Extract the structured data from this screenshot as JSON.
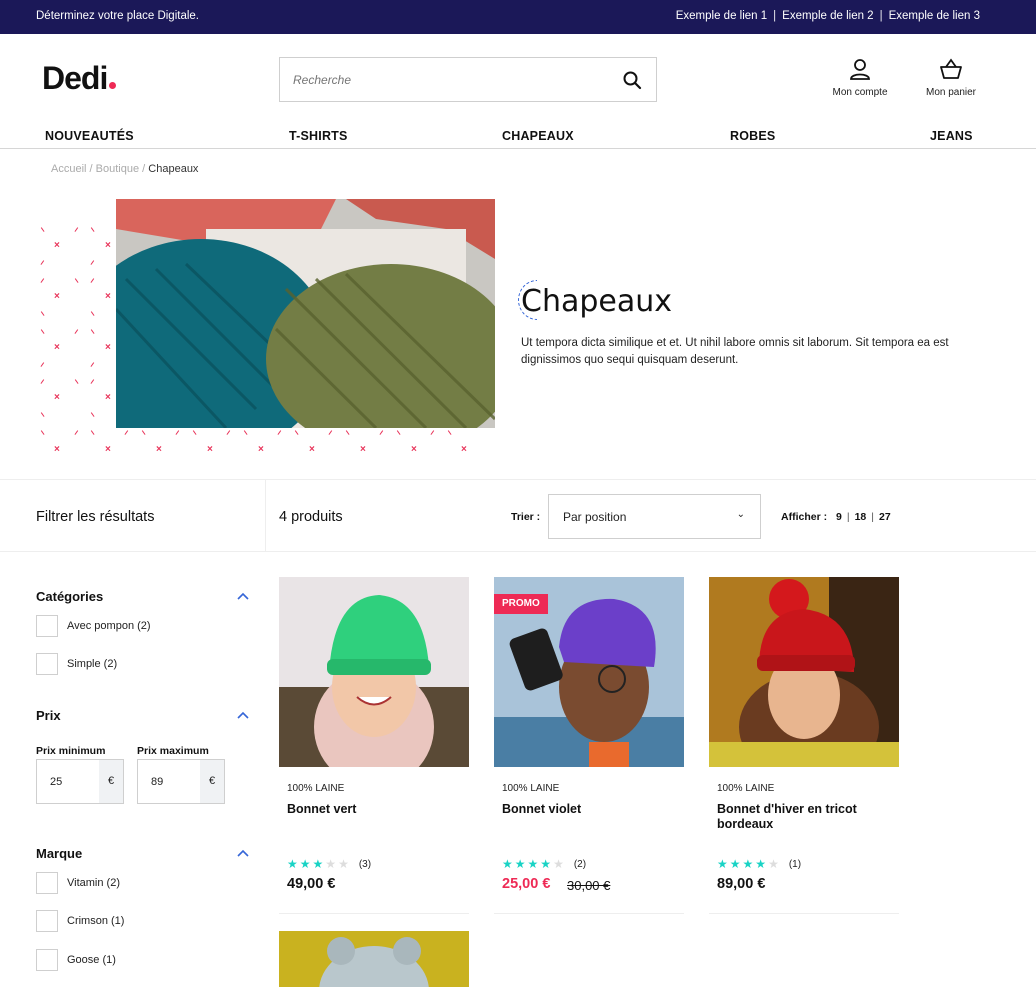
{
  "topbar": {
    "tagline": "Déterminez votre place Digitale.",
    "links": [
      "Exemple de lien 1",
      "Exemple de lien 2",
      "Exemple de lien 3"
    ]
  },
  "header": {
    "logo": "Dedi",
    "search_placeholder": "Recherche",
    "account_label": "Mon compte",
    "cart_label": "Mon panier"
  },
  "nav": [
    "NOUVEAUTÉS",
    "T-SHIRTS",
    "CHAPEAUX",
    "ROBES",
    "JEANS"
  ],
  "breadcrumb": {
    "home": "Accueil",
    "sep1": "/",
    "shop": "Boutique",
    "sep2": "/",
    "current": "Chapeaux"
  },
  "category": {
    "title": "Chapeaux",
    "description": "Ut tempora dicta similique et et. Ut nihil labore omnis sit laborum. Sit tempora ea est dignissimos quo sequi quisquam deserunt."
  },
  "toolbar": {
    "filter_label": "Filtrer les résultats",
    "product_count": "4 produits",
    "sort_label": "Trier :",
    "sort_value": "Par position",
    "show_label": "Afficher :",
    "page_sizes": [
      "9",
      "18",
      "27"
    ],
    "page_sep": "|"
  },
  "filters": {
    "categories": {
      "title": "Catégories",
      "options": [
        "Avec pompon (2)",
        "Simple (2)"
      ]
    },
    "price": {
      "title": "Prix",
      "min_label": "Prix minimum",
      "max_label": "Prix maximum",
      "min_value": "25",
      "max_value": "89",
      "currency": "€"
    },
    "brand": {
      "title": "Marque",
      "options": [
        "Vitamin (2)",
        "Crimson (1)",
        "Goose (1)"
      ]
    }
  },
  "products": [
    {
      "material": "100% LAINE",
      "name": "Bonnet vert",
      "rating": 3,
      "reviews": "(3)",
      "price": "49,00 €",
      "old_price": "",
      "promo": ""
    },
    {
      "material": "100% LAINE",
      "name": "Bonnet violet",
      "rating": 4,
      "reviews": "(2)",
      "price": "25,00 €",
      "old_price": "30,00 €",
      "promo": "PROMO"
    },
    {
      "material": "100% LAINE",
      "name": "Bonnet d'hiver en tricot bordeaux",
      "rating": 4,
      "reviews": "(1)",
      "price": "89,00 €",
      "old_price": "",
      "promo": ""
    }
  ],
  "colors": {
    "topbar": "#1b1858",
    "accent": "#ee2a55",
    "star": "#19d3c5",
    "chevron": "#3566d8"
  },
  "icons": [
    "search-icon",
    "user-icon",
    "basket-icon",
    "chevron-up-icon",
    "chevron-down-icon",
    "star-icon"
  ]
}
